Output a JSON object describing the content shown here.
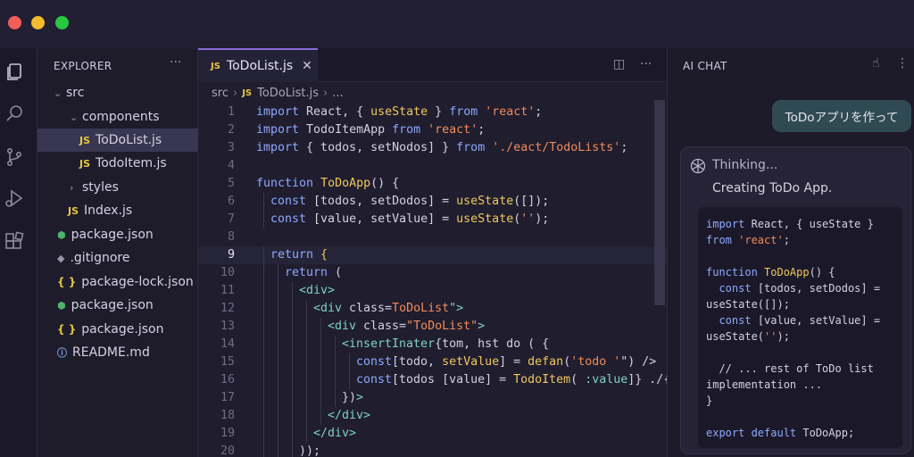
{
  "window": {
    "controls": [
      "close",
      "minimize",
      "maximize"
    ]
  },
  "activity_bar": {
    "icons": [
      "files-icon",
      "search-icon",
      "source-control-icon",
      "run-debug-icon",
      "extensions-icon"
    ]
  },
  "explorer": {
    "header": "EXPLORER",
    "more": "···",
    "items": [
      {
        "label": "src",
        "chevron": "⌄"
      },
      {
        "label": "components",
        "chevron": "⌄"
      },
      {
        "label": "ToDoList.js",
        "icon": "JS"
      },
      {
        "label": "TodoItem.js",
        "icon": "JS"
      },
      {
        "label": "styles",
        "chevron": "›"
      },
      {
        "label": "Index.js",
        "icon": "JS"
      },
      {
        "label": "package.json",
        "icon": "⬢"
      },
      {
        "label": ".gitignore",
        "icon": "◆"
      },
      {
        "label": "package-lock.json",
        "icon": "{ }"
      },
      {
        "label": "package.json",
        "icon": "⬢"
      },
      {
        "label": "package.json",
        "icon": "{ }"
      },
      {
        "label": "README.md",
        "icon": "ⓘ"
      }
    ]
  },
  "editor": {
    "tab": {
      "badge": "JS",
      "label": "ToDoList.js",
      "close": "✕"
    },
    "actions": {
      "split": "◫",
      "more": "···"
    },
    "breadcrumb": {
      "root": "src",
      "sep": "›",
      "badge": "JS",
      "file": "ToDoList.js",
      "tail": "..."
    },
    "current_line": "9",
    "lines": [
      {
        "n": "1",
        "indent": 0,
        "tokens": [
          [
            "kw",
            "import "
          ],
          [
            "pn",
            "React, { "
          ],
          [
            "fn",
            "useState"
          ],
          [
            "pn",
            " } "
          ],
          [
            "kw",
            "from "
          ],
          [
            "str",
            "'react'"
          ],
          [
            "pn",
            ";"
          ]
        ]
      },
      {
        "n": "2",
        "indent": 0,
        "tokens": [
          [
            "kw",
            "import "
          ],
          [
            "pn",
            "TodoItemApp "
          ],
          [
            "kw",
            "from "
          ],
          [
            "str",
            "'react'"
          ],
          [
            "pn",
            ";"
          ]
        ]
      },
      {
        "n": "3",
        "indent": 0,
        "tokens": [
          [
            "kw",
            "import "
          ],
          [
            "pn",
            "{ todos, setNodos] } "
          ],
          [
            "kw",
            "from "
          ],
          [
            "str",
            "'./eact/TodoLists'"
          ],
          [
            "pn",
            ";"
          ]
        ]
      },
      {
        "n": "4",
        "indent": 0,
        "tokens": []
      },
      {
        "n": "5",
        "indent": 0,
        "tokens": [
          [
            "kw",
            "function "
          ],
          [
            "fn",
            "ToDoApp"
          ],
          [
            "pn",
            "() {"
          ]
        ]
      },
      {
        "n": "6",
        "indent": 1,
        "tokens": [
          [
            "kw",
            "const "
          ],
          [
            "pn",
            "[todos, setDodos] = "
          ],
          [
            "fn",
            "useState"
          ],
          [
            "pn",
            "([]);"
          ]
        ]
      },
      {
        "n": "7",
        "indent": 1,
        "tokens": [
          [
            "kw",
            "const "
          ],
          [
            "pn",
            "[value, setValue] = "
          ],
          [
            "fn",
            "useState"
          ],
          [
            "pn",
            "("
          ],
          [
            "str",
            "''"
          ],
          [
            "pn",
            ");"
          ]
        ]
      },
      {
        "n": "8",
        "indent": 0,
        "tokens": []
      },
      {
        "n": "9",
        "indent": 1,
        "tokens": [
          [
            "kw",
            "return "
          ],
          [
            "fn",
            "{"
          ]
        ]
      },
      {
        "n": "10",
        "indent": 2,
        "tokens": [
          [
            "kw",
            "return "
          ],
          [
            "pn",
            "("
          ]
        ]
      },
      {
        "n": "11",
        "indent": 3,
        "tokens": [
          [
            "tg",
            "<div>"
          ]
        ]
      },
      {
        "n": "12",
        "indent": 4,
        "tokens": [
          [
            "tg",
            "<div "
          ],
          [
            "pn",
            "class="
          ],
          [
            "str",
            "ToDoList"
          ],
          [
            "tg",
            "\">"
          ]
        ]
      },
      {
        "n": "13",
        "indent": 5,
        "tokens": [
          [
            "tg",
            "<div "
          ],
          [
            "pn",
            "class="
          ],
          [
            "str",
            "\"ToDoList\""
          ],
          [
            "tg",
            ">"
          ]
        ]
      },
      {
        "n": "14",
        "indent": 6,
        "tokens": [
          [
            "tg",
            "<insertInater"
          ],
          [
            "pn",
            "{tom, hst do ( {"
          ]
        ]
      },
      {
        "n": "15",
        "indent": 7,
        "tokens": [
          [
            "kw",
            "const"
          ],
          [
            "pn",
            "[todo, "
          ],
          [
            "fn",
            "setValue"
          ],
          [
            "pn",
            "] = "
          ],
          [
            "fn",
            "defan"
          ],
          [
            "pn",
            "("
          ],
          [
            "str",
            "'todo '"
          ],
          [
            "pn",
            "\") />"
          ]
        ]
      },
      {
        "n": "16",
        "indent": 7,
        "tokens": [
          [
            "kw",
            "const"
          ],
          [
            "pn",
            "[todos [value] = "
          ],
          [
            "fn",
            "TodoItem"
          ],
          [
            "pn",
            "( "
          ],
          [
            "tg",
            ":value"
          ],
          [
            "pn",
            "]} ./{tos"
          ]
        ]
      },
      {
        "n": "17",
        "indent": 6,
        "tokens": [
          [
            "pn",
            "})"
          ],
          [
            "tg",
            ">"
          ]
        ]
      },
      {
        "n": "18",
        "indent": 5,
        "tokens": [
          [
            "tg",
            "</div>"
          ]
        ]
      },
      {
        "n": "19",
        "indent": 4,
        "tokens": [
          [
            "tg",
            "</div>"
          ]
        ]
      },
      {
        "n": "20",
        "indent": 3,
        "tokens": [
          [
            "pn",
            "));"
          ]
        ]
      }
    ]
  },
  "chat": {
    "title": "AI CHAT",
    "actions": {
      "hand": "☝",
      "more": "⋮"
    },
    "user_message": "ToDoアプリを作って",
    "ai": {
      "thinking": "Thinking...",
      "status": "Creating ToDo App.",
      "code": [
        [
          [
            "kw",
            "import "
          ],
          [
            "pn",
            "React, { useState }"
          ]
        ],
        [
          [
            "kw",
            "from "
          ],
          [
            "str",
            "'react'"
          ],
          [
            "pn",
            ";"
          ]
        ],
        [],
        [
          [
            "kw",
            "function "
          ],
          [
            "fn",
            "ToDoApp"
          ],
          [
            "pn",
            "() {"
          ]
        ],
        [
          [
            "pn",
            "  "
          ],
          [
            "kw",
            "const "
          ],
          [
            "pn",
            "[todos, setDodos] ="
          ]
        ],
        [
          [
            "pn",
            "useState([]);"
          ]
        ],
        [
          [
            "pn",
            "  "
          ],
          [
            "kw",
            "const "
          ],
          [
            "pn",
            "[value, setValue] ="
          ]
        ],
        [
          [
            "pn",
            "useState("
          ],
          [
            "str",
            "''"
          ],
          [
            "pn",
            ");"
          ]
        ],
        [],
        [
          [
            "pn",
            "  // ... rest of ToDo list"
          ]
        ],
        [
          [
            "pn",
            "implementation ..."
          ]
        ],
        [
          [
            "pn",
            "}"
          ]
        ],
        [],
        [
          [
            "kw",
            "export default "
          ],
          [
            "pn",
            "ToDoApp;"
          ]
        ]
      ]
    }
  },
  "colors": {
    "accent": "#8c6bd8",
    "keyword": "#8fa8ff",
    "function": "#f0c75e",
    "string": "#f08b5a",
    "tag": "#7fd0c8",
    "user_bubble": "#2f4a52"
  }
}
